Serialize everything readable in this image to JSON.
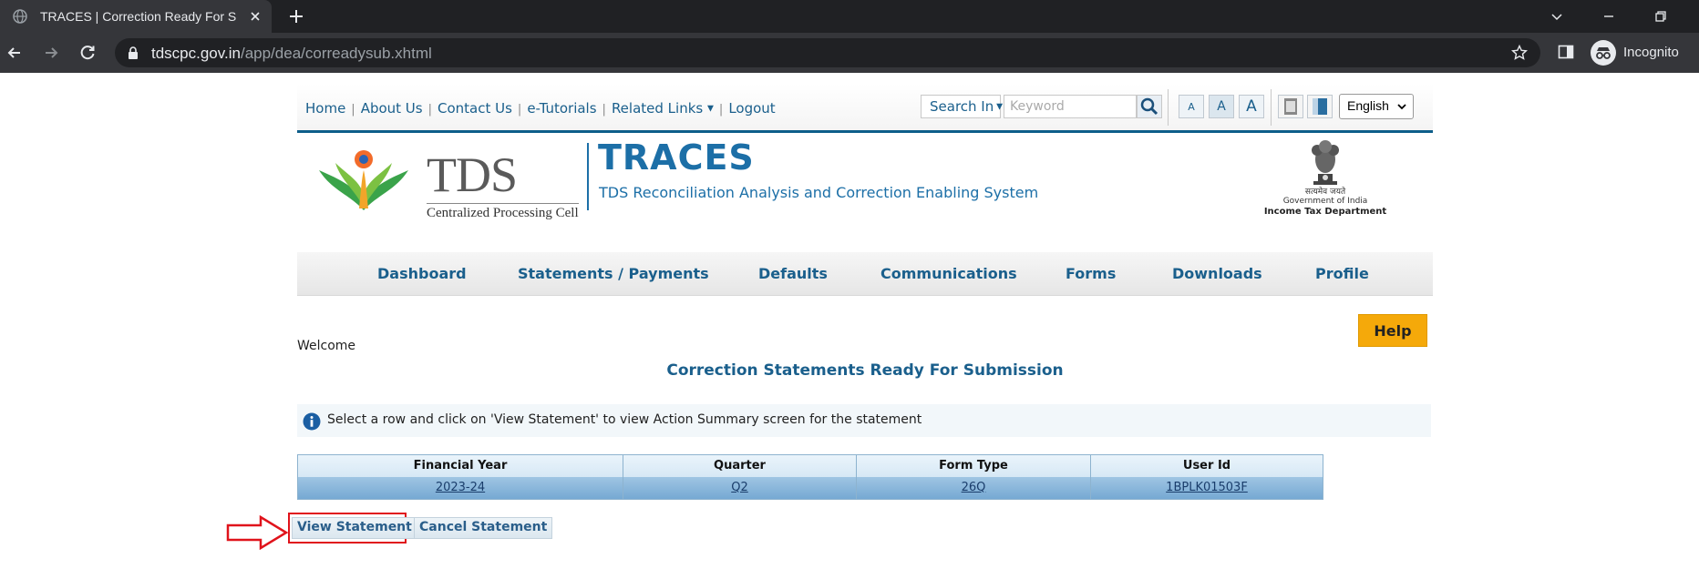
{
  "browser": {
    "tab_title": "TRACES | Correction Ready For S",
    "url_host": "tdscpc.gov.in",
    "url_path": "/app/dea/correadysub.xhtml",
    "profile_label": "Incognito"
  },
  "header": {
    "links": {
      "home": "Home",
      "about": "About Us",
      "contact": "Contact Us",
      "tutorials": "e-Tutorials",
      "related": "Related Links",
      "logout": "Logout"
    },
    "search_in_label": "Search In",
    "keyword_placeholder": "Keyword",
    "font_small": "A",
    "font_medium": "A",
    "font_large": "A",
    "language": "English"
  },
  "banner": {
    "tds_word": "TDS",
    "tds_sub": "Centralized Processing Cell",
    "title": "TRACES",
    "subtitle": "TDS Reconciliation Analysis and Correction Enabling System",
    "gov_hindi": "सत्यमेव जयते",
    "gov_line": "Government of India",
    "dept_line": "Income Tax Department"
  },
  "nav": {
    "dashboard": "Dashboard",
    "statements": "Statements / Payments",
    "defaults": "Defaults",
    "communications": "Communications",
    "forms": "Forms",
    "downloads": "Downloads",
    "profile": "Profile"
  },
  "help_label": "Help",
  "welcome": "Welcome",
  "page_title": "Correction Statements Ready For Submission",
  "info_text": "Select a row and click on 'View Statement' to view Action Summary screen for the statement",
  "table": {
    "headers": [
      "Financial Year",
      "Quarter",
      "Form Type",
      "User Id"
    ],
    "rows": [
      [
        "2023-24",
        "Q2",
        "26Q",
        "1BPLK01503F"
      ]
    ]
  },
  "actions": {
    "view": "View Statement",
    "cancel": "Cancel Statement"
  },
  "colors": {
    "brand_blue": "#1a5f8c",
    "help_orange": "#f5a90a",
    "highlight_red": "#e0131b",
    "selected_row": "#8ab7dc"
  }
}
